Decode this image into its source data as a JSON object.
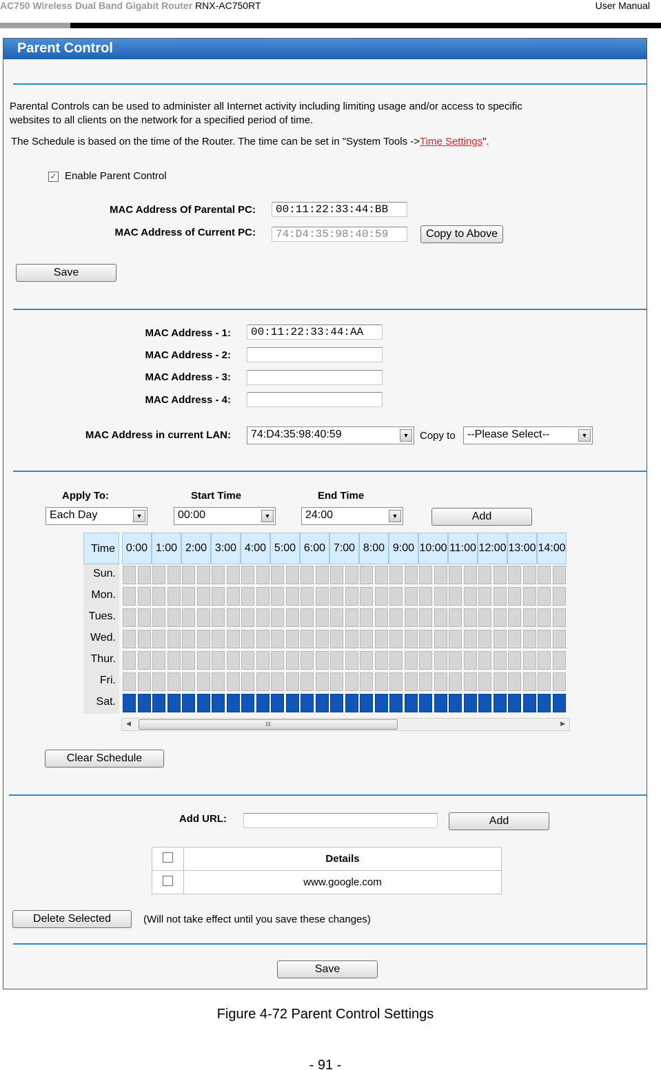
{
  "doc_header": {
    "product": "AC750 Wireless Dual Band Gigabit Router",
    "model": "RNX-AC750RT",
    "manual": "User Manual"
  },
  "panel": {
    "title": "Parent Control",
    "description_line1": "Parental Controls can be used to administer all Internet activity including limiting usage and/or access to specific",
    "description_line2": "websites to all clients on the network for a specified period of time.",
    "schedule_note_prefix": "The Schedule is based on the time of the Router. The time can be set in \"System Tools ->",
    "schedule_note_link": "Time Settings",
    "schedule_note_suffix": "\".",
    "enable_label": "Enable Parent Control",
    "enable_checked": true,
    "mac_parental_label": "MAC Address Of Parental PC:",
    "mac_parental_value": "00:11:22:33:44:BB",
    "mac_current_label": "MAC Address of Current PC:",
    "mac_current_value": "74:D4:35:98:40:59",
    "copy_above_label": "Copy to Above",
    "save_label": "Save"
  },
  "mac_list": {
    "items": [
      {
        "label": "MAC Address - 1:",
        "value": "00:11:22:33:44:AA"
      },
      {
        "label": "MAC Address - 2:",
        "value": ""
      },
      {
        "label": "MAC Address - 3:",
        "value": ""
      },
      {
        "label": "MAC Address - 4:",
        "value": ""
      }
    ],
    "lan_label": "MAC Address in current LAN:",
    "lan_selected": "74:D4:35:98:40:59",
    "copy_to_label": "Copy to",
    "copy_to_selected": "--Please Select--"
  },
  "schedule": {
    "apply_to_label": "Apply To:",
    "apply_to_value": "Each Day",
    "start_time_label": "Start Time",
    "start_time_value": "00:00",
    "end_time_label": "End Time",
    "end_time_value": "24:00",
    "add_label": "Add",
    "time_header": "Time",
    "hours": [
      "0:00",
      "1:00",
      "2:00",
      "3:00",
      "4:00",
      "5:00",
      "6:00",
      "7:00",
      "8:00",
      "9:00",
      "10:00",
      "11:00",
      "12:00",
      "13:00",
      "14:00"
    ],
    "days": [
      "Sun.",
      "Mon.",
      "Tues.",
      "Wed.",
      "Thur.",
      "Fri.",
      "Sat."
    ],
    "active_days": [
      "Sat."
    ],
    "scroll_thumb": "III",
    "clear_label": "Clear Schedule"
  },
  "url": {
    "add_url_label": "Add URL:",
    "add_url_value": "",
    "add_label": "Add",
    "details_header": "Details",
    "entries": [
      "www.google.com"
    ],
    "delete_label": "Delete Selected",
    "delete_note": "(Will not take effect until you save these changes)",
    "save_label": "Save"
  },
  "caption": "Figure 4-72 Parent Control Settings",
  "page_number": "- 91 -",
  "colors": {
    "title_bar": "#1e62b4",
    "rule": "#2a88c8",
    "link": "#e8202a",
    "schedule_active": "#1155b8",
    "schedule_header": "#d4ecfb"
  }
}
